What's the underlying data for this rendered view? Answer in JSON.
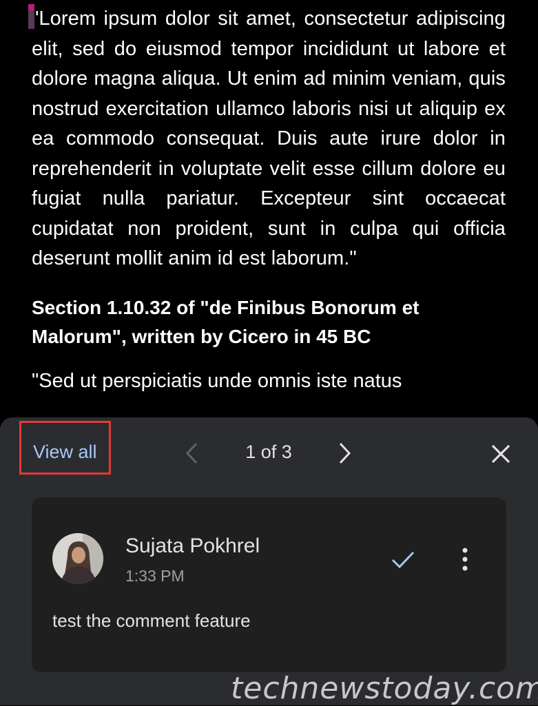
{
  "document": {
    "paragraph1": "\"Lorem ipsum dolor sit amet, consectetur adipiscing elit, sed do eiusmod tempor incididunt ut labore et dolore magna aliqua. Ut enim ad minim veniam, quis nostrud exercitation ullamco laboris nisi ut aliquip ex ea commodo consequat. Duis aute irure dolor in reprehenderit in voluptate velit esse cillum dolore eu fugiat nulla pariatur. Excepteur sint occaecat cupidatat non proident, sunt in culpa qui officia deserunt mollit anim id est laborum.\"",
    "heading": "Section 1.10.32 of \"de Finibus Bonorum et Malorum\", written by Cicero in 45 BC",
    "paragraph2_partial": "\"Sed ut perspiciatis unde omnis iste natus"
  },
  "comments_sheet": {
    "view_all_label": "View all",
    "counter": "1 of 3",
    "prev_icon": "chevron-left-icon",
    "next_icon": "chevron-right-icon",
    "close_icon": "close-icon",
    "comment": {
      "author": "Sujata Pokhrel",
      "time": "1:33 PM",
      "text": "test the comment feature",
      "resolve_icon": "check-icon",
      "more_icon": "more-vert-icon"
    }
  },
  "colors": {
    "accent": "#a8c7fa",
    "highlight_border": "#e53935",
    "sheet_bg": "#2b2c2f",
    "card_bg": "#1f1f1f"
  },
  "watermark": "technewstoday.com"
}
